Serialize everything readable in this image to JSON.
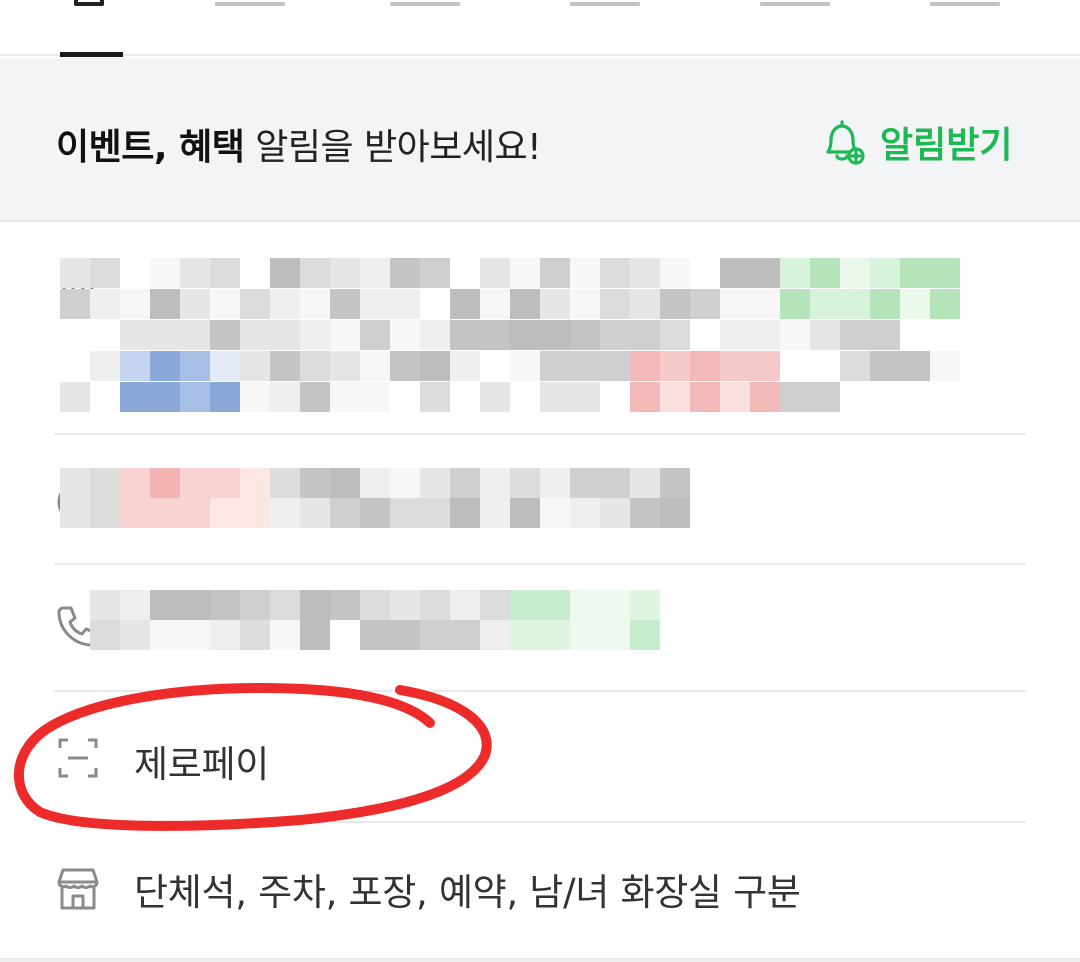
{
  "tabs": {
    "active_index": 0
  },
  "banner": {
    "bold_text": "이벤트, 혜택",
    "text": " 알림을 받아보세요!",
    "action_label": "알림받기",
    "action_icon": "bell-plus-icon",
    "accent_color": "#1db954"
  },
  "rows": [
    {
      "icon": "location-pin-icon",
      "redacted": true
    },
    {
      "icon": "clock-icon",
      "redacted": true
    },
    {
      "icon": "phone-icon",
      "redacted": true
    },
    {
      "icon": "zeropay-scan-icon",
      "label": "제로페이"
    },
    {
      "icon": "store-icon",
      "label": "단체석, 주차, 포장, 예약, 남/녀 화장실 구분"
    }
  ],
  "annotation": {
    "color": "#ee2b2b",
    "shape": "hand-drawn-ellipse",
    "target": "제로페이"
  }
}
